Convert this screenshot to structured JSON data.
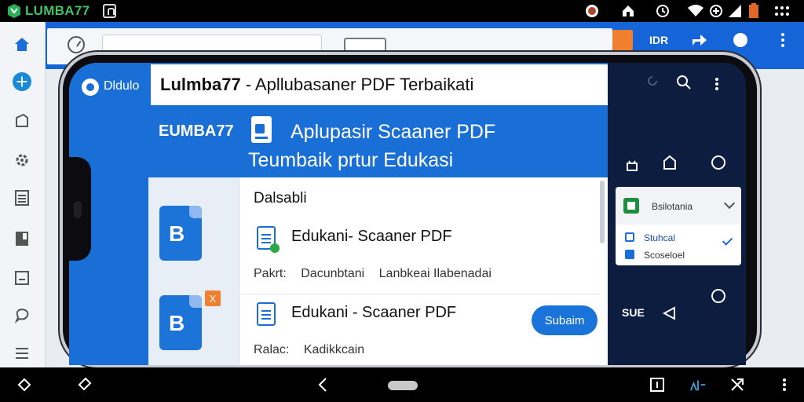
{
  "statusbar": {
    "brand": "LUMBA77"
  },
  "background_app": {
    "right_label": "IDR"
  },
  "phone_app": {
    "header_brand": "Dldulo",
    "title_brand": "Lulmba77",
    "title_rest": "- Apllubasaner PDF Terbaikati",
    "banner_brand": "EUMBA77",
    "banner_line1": "Aplupasir Scaaner PDF",
    "banner_line2": "Teumbaik prtur Edukasi",
    "sheet_title": "Dalsabli",
    "items": [
      {
        "title": "Edukani- Scaaner PDF",
        "meta_label": "Pakrt:",
        "meta_a": "Dacunbtani",
        "meta_b": "Lanbkeai Ilabenadai"
      },
      {
        "title": "Edukani - Scaaner PDF",
        "meta_label": "Ralac:",
        "meta_a": "Kadikkcain",
        "meta_b": "",
        "button": "Subaim"
      }
    ],
    "big_app_letter_1": "B",
    "big_app_letter_2": "B",
    "big_app_badge": "X"
  },
  "side_panel": {
    "dropdown_label": "Bsilotania",
    "options": [
      "Stuhcal",
      "Scoseloel"
    ],
    "bottom_text": "SUE"
  },
  "colors": {
    "primary": "#1a6fd6",
    "dark_panel": "#0c1d40",
    "brand_green": "#3fc16a"
  }
}
